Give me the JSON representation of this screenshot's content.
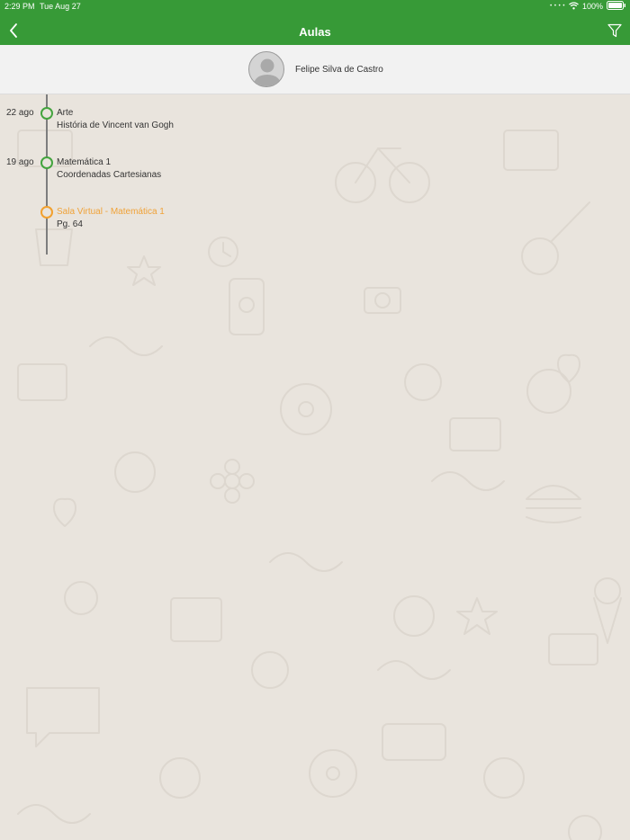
{
  "status_bar": {
    "time": "2:29 PM",
    "date": "Tue Aug 27",
    "battery": "100%"
  },
  "nav": {
    "title": "Aulas",
    "back_icon": "chevron-left-icon",
    "filter_icon": "filter-icon"
  },
  "profile": {
    "name": "Felipe Silva de Castro",
    "avatar_icon": "user-avatar-icon"
  },
  "timeline": {
    "items": [
      {
        "date": "22 ago",
        "title": "Arte",
        "subtitle": "História de Vincent van Gogh",
        "status": "done"
      },
      {
        "date": "19 ago",
        "title": "Matemática 1",
        "subtitle": "Coordenadas Cartesianas",
        "status": "done"
      },
      {
        "date": "",
        "title": "Sala Virtual - Matemática 1",
        "subtitle": "Pg. 64",
        "status": "pending"
      }
    ]
  },
  "colors": {
    "header_green": "#379a37",
    "done_node": "#43a43e",
    "pending_node": "#f2a02e",
    "background": "#e9e4dd"
  }
}
